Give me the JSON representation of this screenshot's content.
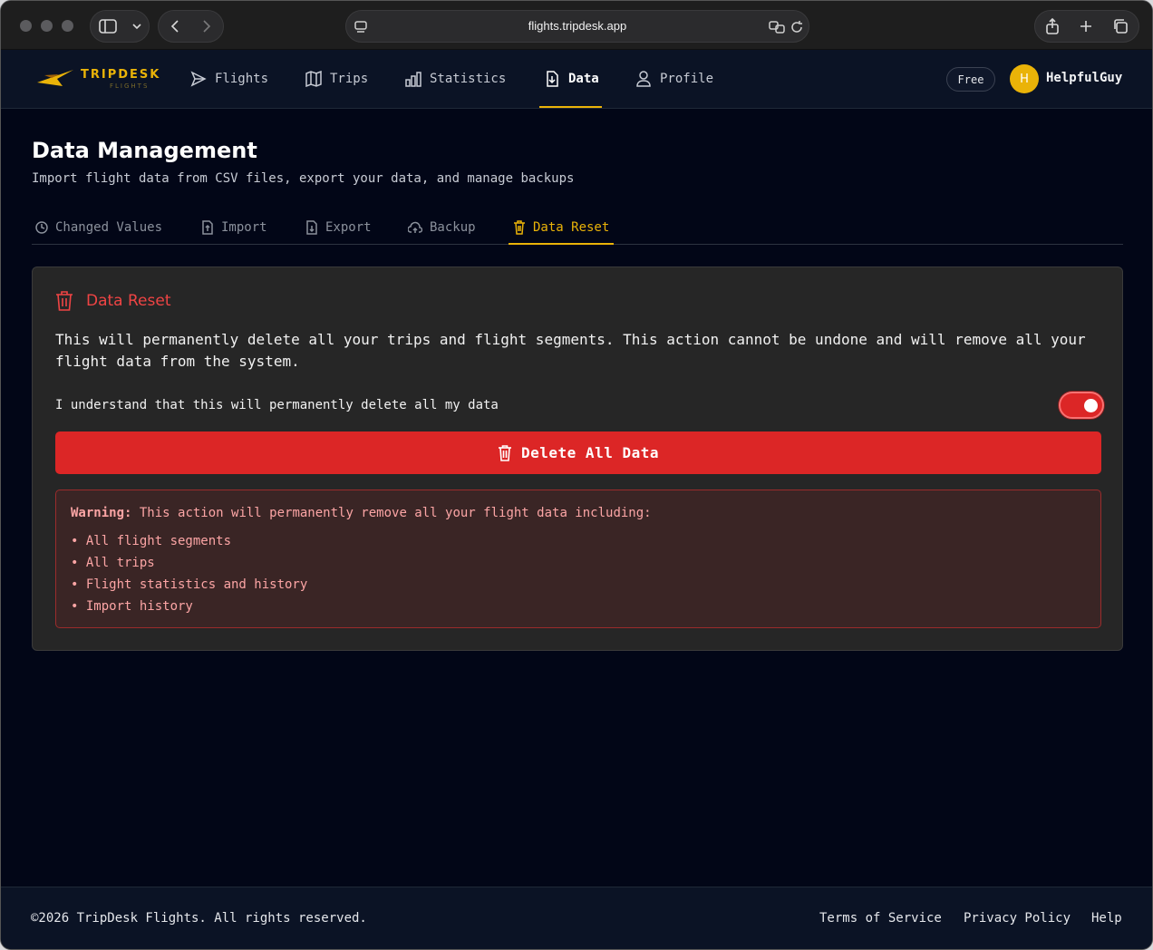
{
  "browser": {
    "url": "flights.tripdesk.app"
  },
  "app": {
    "logo_text": "TRIPDESK",
    "logo_sub": "FLIGHTS",
    "nav": [
      {
        "label": "Flights",
        "icon": "send-icon"
      },
      {
        "label": "Trips",
        "icon": "map-icon"
      },
      {
        "label": "Statistics",
        "icon": "bar-chart-icon"
      },
      {
        "label": "Data",
        "icon": "file-import-icon",
        "active": true
      },
      {
        "label": "Profile",
        "icon": "user-icon"
      }
    ],
    "plan_badge": "Free",
    "avatar_initial": "H",
    "username": "HelpfulGuy"
  },
  "page": {
    "title": "Data Management",
    "subtitle": "Import flight data from CSV files, export your data, and manage backups",
    "tabs": [
      {
        "label": "Changed Values",
        "icon": "clock-icon"
      },
      {
        "label": "Import",
        "icon": "file-upload-icon"
      },
      {
        "label": "Export",
        "icon": "file-download-icon"
      },
      {
        "label": "Backup",
        "icon": "cloud-upload-icon"
      },
      {
        "label": "Data Reset",
        "icon": "trash-icon",
        "active": true
      }
    ]
  },
  "reset_card": {
    "title": "Data Reset",
    "description": "This will permanently delete all your trips and flight segments. This action cannot be undone and will remove all your flight data from the system.",
    "confirm_label": "I understand that this will permanently delete all my data",
    "confirm_checked": true,
    "delete_button": "Delete All Data",
    "warning_prefix": "Warning:",
    "warning_text": " This action will permanently remove all your flight data including:",
    "warning_items": [
      "All flight segments",
      "All trips",
      "Flight statistics and history",
      "Import history"
    ]
  },
  "footer": {
    "copyright": "©2026 TripDesk Flights. All rights reserved.",
    "links": [
      "Terms of Service",
      "Privacy Policy",
      "Help"
    ]
  },
  "colors": {
    "accent": "#eab308",
    "danger": "#dc2626",
    "background": "#020617"
  }
}
